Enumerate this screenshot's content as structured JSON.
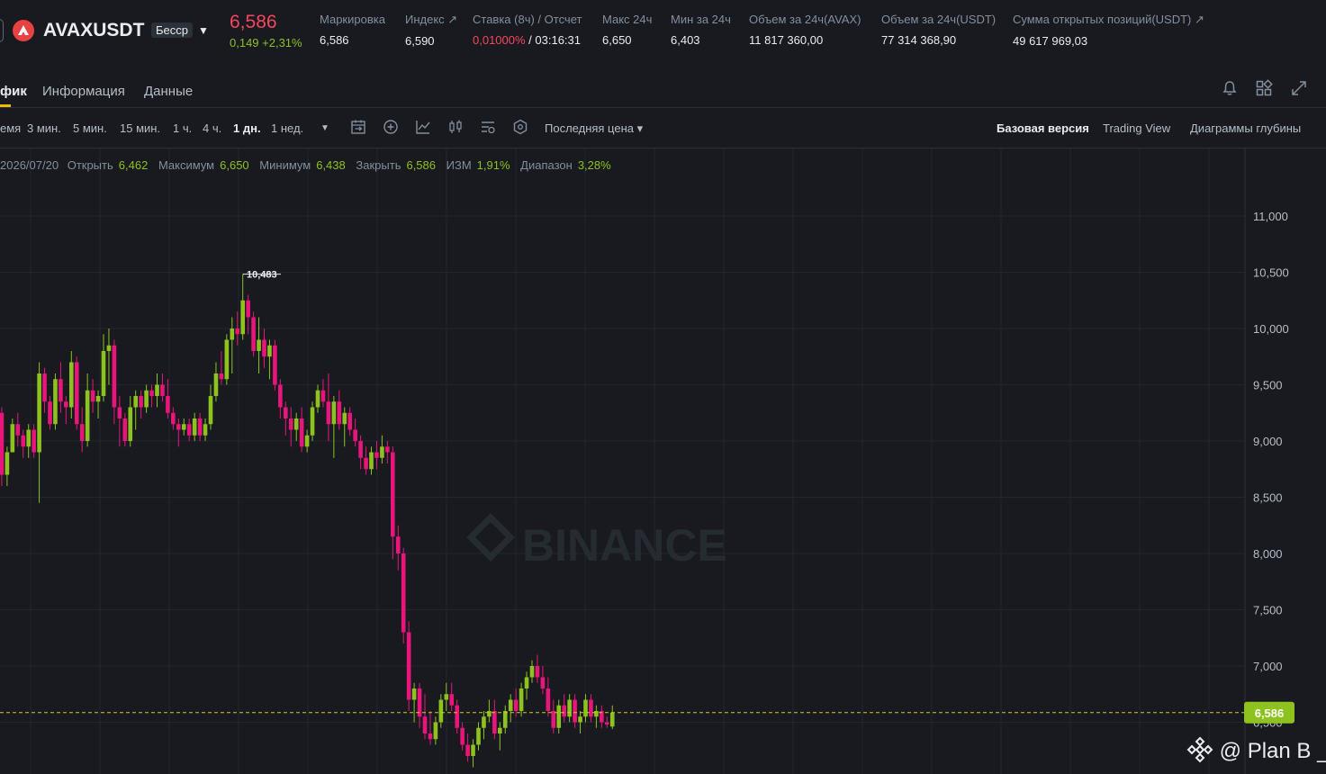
{
  "ticker": {
    "symbol": "AVAXUSDT",
    "badge": "Бесср",
    "last_price": "6,586",
    "change": "0,149 +2,31%",
    "stats": [
      {
        "label": "Маркировка",
        "value": "6,586"
      },
      {
        "label": "Индекс ↗",
        "value": "6,590"
      },
      {
        "label": "Ставка (8ч) / Отсчет",
        "value_red": "0,01000%",
        "value": " / 03:16:31"
      },
      {
        "label": "Макс 24ч",
        "value": "6,650"
      },
      {
        "label": "Мин за 24ч",
        "value": "6,403"
      },
      {
        "label": "Объем за 24ч(AVAX)",
        "value": "11 817 360,00"
      },
      {
        "label": "Объем за 24ч(USDT)",
        "value": "77 314 368,90"
      },
      {
        "label": "Сумма открытых позиций(USDT) ↗",
        "value": "49 617 969,03"
      }
    ]
  },
  "tabs": [
    {
      "label": "фик"
    },
    {
      "label": "Информация"
    },
    {
      "label": "Данные"
    }
  ],
  "toolbar": {
    "timeframes": [
      "емя",
      "3 мин.",
      "5 мин.",
      "15 мин.",
      "1 ч.",
      "4 ч.",
      "1 дн.",
      "1 нед."
    ],
    "active_timeframe": "1 дн.",
    "price_type": "Последняя цена ▾",
    "views": [
      "Базовая версия",
      "Trading View",
      "Диаграммы глубины"
    ],
    "active_view": "Базовая версия"
  },
  "ohlc": {
    "date": "2026/07/20",
    "open_label": "Открыть",
    "open": "6,462",
    "high_label": "Максимум",
    "high": "6,650",
    "low_label": "Минимум",
    "low": "6,438",
    "close_label": "Закрыть",
    "close": "6,586",
    "change_label": "ИЗМ",
    "change": "1,91%",
    "range_label": "Диапазон",
    "range": "3,28%"
  },
  "chart_data": {
    "type": "candlestick",
    "y_ticks": [
      "11,000",
      "10,500",
      "10,000",
      "9,500",
      "9,000",
      "8,500",
      "8,000",
      "7,500",
      "7,000",
      "6,500"
    ],
    "ylim": [
      6.2,
      11.5
    ],
    "last_price_label": "6,586",
    "last_price": 6.586,
    "high_marker": "10,483",
    "watermark": "BINANCE",
    "colors": {
      "up": "#8dc21f",
      "down": "#e8157a",
      "last_line": "#c8d21f"
    },
    "candles": [
      [
        9.1,
        9.35,
        8.95,
        9.25
      ],
      [
        9.25,
        9.3,
        8.6,
        8.7
      ],
      [
        8.7,
        8.95,
        8.6,
        8.9
      ],
      [
        8.9,
        9.2,
        8.9,
        9.15
      ],
      [
        9.15,
        9.25,
        8.95,
        9.05
      ],
      [
        9.05,
        9.1,
        8.85,
        8.95
      ],
      [
        8.95,
        9.15,
        8.85,
        9.1
      ],
      [
        9.1,
        9.15,
        8.85,
        8.9
      ],
      [
        8.9,
        9.7,
        8.45,
        9.6
      ],
      [
        9.6,
        9.65,
        9.25,
        9.35
      ],
      [
        9.35,
        9.4,
        9.1,
        9.15
      ],
      [
        9.15,
        9.6,
        9.1,
        9.55
      ],
      [
        9.55,
        9.7,
        9.25,
        9.35
      ],
      [
        9.35,
        9.4,
        9.15,
        9.3
      ],
      [
        9.3,
        9.8,
        9.2,
        9.7
      ],
      [
        9.7,
        9.75,
        9.1,
        9.15
      ],
      [
        9.15,
        9.3,
        8.9,
        9.0
      ],
      [
        9.0,
        9.6,
        8.95,
        9.45
      ],
      [
        9.45,
        9.55,
        9.25,
        9.35
      ],
      [
        9.35,
        9.45,
        9.2,
        9.4
      ],
      [
        9.4,
        9.95,
        9.35,
        9.8
      ],
      [
        9.8,
        10.0,
        9.5,
        9.85
      ],
      [
        9.85,
        9.9,
        9.15,
        9.3
      ],
      [
        9.3,
        9.4,
        8.95,
        9.2
      ],
      [
        9.2,
        9.25,
        8.95,
        9.0
      ],
      [
        9.0,
        9.4,
        8.95,
        9.3
      ],
      [
        9.3,
        9.45,
        9.1,
        9.4
      ],
      [
        9.4,
        9.45,
        9.2,
        9.3
      ],
      [
        9.3,
        9.5,
        9.25,
        9.45
      ],
      [
        9.45,
        9.5,
        9.3,
        9.4
      ],
      [
        9.4,
        9.6,
        9.3,
        9.5
      ],
      [
        9.5,
        9.6,
        9.35,
        9.4
      ],
      [
        9.4,
        9.55,
        9.2,
        9.25
      ],
      [
        9.25,
        9.3,
        9.1,
        9.15
      ],
      [
        9.15,
        9.2,
        8.95,
        9.1
      ],
      [
        9.1,
        9.2,
        9.05,
        9.15
      ],
      [
        9.15,
        9.2,
        9.0,
        9.05
      ],
      [
        9.05,
        9.25,
        9.0,
        9.2
      ],
      [
        9.2,
        9.25,
        9.0,
        9.05
      ],
      [
        9.05,
        9.2,
        9.0,
        9.15
      ],
      [
        9.15,
        9.5,
        9.1,
        9.4
      ],
      [
        9.4,
        9.7,
        9.35,
        9.6
      ],
      [
        9.6,
        9.8,
        9.5,
        9.55
      ],
      [
        9.55,
        9.95,
        9.5,
        9.9
      ],
      [
        9.9,
        10.1,
        9.6,
        10.0
      ],
      [
        10.0,
        10.15,
        9.85,
        9.95
      ],
      [
        9.95,
        10.483,
        9.9,
        10.25
      ],
      [
        10.25,
        10.3,
        9.95,
        10.1
      ],
      [
        10.1,
        10.15,
        9.75,
        9.8
      ],
      [
        9.8,
        10.1,
        9.6,
        9.9
      ],
      [
        9.9,
        10.0,
        9.65,
        9.75
      ],
      [
        9.75,
        9.9,
        9.55,
        9.85
      ],
      [
        9.85,
        9.9,
        9.45,
        9.5
      ],
      [
        9.5,
        9.55,
        9.2,
        9.3
      ],
      [
        9.3,
        9.35,
        9.05,
        9.2
      ],
      [
        9.2,
        9.3,
        8.95,
        9.1
      ],
      [
        9.1,
        9.25,
        9.0,
        9.2
      ],
      [
        9.2,
        9.3,
        8.9,
        8.95
      ],
      [
        8.95,
        9.1,
        8.9,
        9.05
      ],
      [
        9.05,
        9.35,
        9.0,
        9.3
      ],
      [
        9.3,
        9.5,
        9.25,
        9.45
      ],
      [
        9.45,
        9.55,
        9.3,
        9.35
      ],
      [
        9.35,
        9.6,
        9.0,
        9.15
      ],
      [
        9.15,
        9.4,
        8.85,
        9.35
      ],
      [
        9.35,
        9.45,
        9.1,
        9.15
      ],
      [
        9.15,
        9.3,
        8.95,
        9.25
      ],
      [
        9.25,
        9.3,
        9.05,
        9.1
      ],
      [
        9.1,
        9.2,
        8.95,
        9.0
      ],
      [
        9.0,
        9.05,
        8.75,
        8.85
      ],
      [
        8.85,
        8.95,
        8.7,
        8.75
      ],
      [
        8.75,
        8.95,
        8.7,
        8.9
      ],
      [
        8.9,
        9.0,
        8.75,
        8.85
      ],
      [
        8.85,
        9.05,
        8.8,
        8.95
      ],
      [
        8.95,
        9.0,
        8.8,
        8.9
      ],
      [
        8.9,
        8.95,
        7.95,
        8.15
      ],
      [
        8.15,
        8.25,
        7.85,
        8.0
      ],
      [
        8.0,
        8.05,
        7.2,
        7.3
      ],
      [
        7.3,
        7.4,
        6.6,
        6.7
      ],
      [
        6.7,
        6.85,
        6.5,
        6.8
      ],
      [
        6.8,
        6.85,
        6.45,
        6.55
      ],
      [
        6.55,
        6.75,
        6.35,
        6.4
      ],
      [
        6.4,
        6.6,
        6.3,
        6.35
      ],
      [
        6.35,
        6.55,
        6.3,
        6.5
      ],
      [
        6.5,
        6.75,
        6.45,
        6.7
      ],
      [
        6.7,
        6.85,
        6.6,
        6.75
      ],
      [
        6.75,
        6.85,
        6.6,
        6.65
      ],
      [
        6.65,
        6.7,
        6.4,
        6.45
      ],
      [
        6.45,
        6.5,
        6.25,
        6.3
      ],
      [
        6.3,
        6.4,
        6.15,
        6.2
      ],
      [
        6.2,
        6.35,
        6.1,
        6.3
      ],
      [
        6.3,
        6.5,
        6.25,
        6.45
      ],
      [
        6.45,
        6.6,
        6.35,
        6.55
      ],
      [
        6.55,
        6.7,
        6.5,
        6.6
      ],
      [
        6.6,
        6.7,
        6.35,
        6.4
      ],
      [
        6.4,
        6.5,
        6.25,
        6.45
      ],
      [
        6.45,
        6.65,
        6.4,
        6.6
      ],
      [
        6.6,
        6.75,
        6.5,
        6.7
      ],
      [
        6.7,
        6.8,
        6.55,
        6.6
      ],
      [
        6.6,
        6.85,
        6.55,
        6.8
      ],
      [
        6.8,
        6.95,
        6.7,
        6.9
      ],
      [
        6.9,
        7.05,
        6.85,
        7.0
      ],
      [
        7.0,
        7.1,
        6.85,
        6.9
      ],
      [
        6.9,
        7.0,
        6.75,
        6.8
      ],
      [
        6.8,
        6.9,
        6.55,
        6.6
      ],
      [
        6.6,
        6.7,
        6.4,
        6.45
      ],
      [
        6.45,
        6.7,
        6.4,
        6.65
      ],
      [
        6.65,
        6.75,
        6.5,
        6.55
      ],
      [
        6.55,
        6.75,
        6.5,
        6.7
      ],
      [
        6.7,
        6.75,
        6.45,
        6.5
      ],
      [
        6.5,
        6.6,
        6.4,
        6.55
      ],
      [
        6.55,
        6.75,
        6.5,
        6.7
      ],
      [
        6.7,
        6.75,
        6.5,
        6.55
      ],
      [
        6.55,
        6.65,
        6.45,
        6.6
      ],
      [
        6.6,
        6.65,
        6.45,
        6.5
      ],
      [
        6.5,
        6.55,
        6.45,
        6.48
      ],
      [
        6.462,
        6.65,
        6.438,
        6.586
      ]
    ]
  },
  "watermark_credit": "@ Plan B _"
}
